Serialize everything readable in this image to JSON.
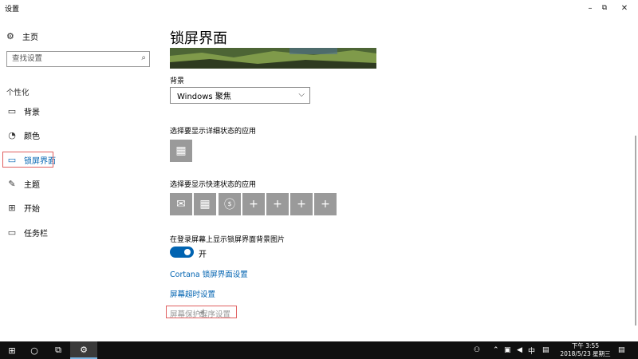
{
  "window": {
    "title": "设置",
    "minimize_icon": "minimize-icon",
    "maximize_icon": "restore-icon",
    "close_icon": "close-icon"
  },
  "sidebar": {
    "home_label": "主页",
    "search_placeholder": "查找设置",
    "section": "个性化",
    "items": [
      {
        "label": "背景",
        "icon": "picture-icon"
      },
      {
        "label": "颜色",
        "icon": "palette-icon"
      },
      {
        "label": "锁屏界面",
        "icon": "lock-screen-icon",
        "active": true
      },
      {
        "label": "主题",
        "icon": "brush-icon"
      },
      {
        "label": "开始",
        "icon": "start-grid-icon"
      },
      {
        "label": "任务栏",
        "icon": "taskbar-icon"
      }
    ]
  },
  "main": {
    "title": "锁屏界面",
    "background_label": "背景",
    "background_value": "Windows 聚焦",
    "detailed_status_label": "选择要显示详细状态的应用",
    "quick_status_label": "选择要显示快速状态的应用",
    "signin_bg_label": "在登录屏幕上显示锁屏界面背景图片",
    "signin_bg_state": "开",
    "links": {
      "cortana": "Cortana 锁屏界面设置",
      "timeout": "屏幕超时设置",
      "screensaver": "屏幕保护程序设置"
    },
    "quick_tiles": [
      "mail-icon",
      "calendar-icon",
      "skype-icon",
      "plus-icon",
      "plus-icon",
      "plus-icon",
      "plus-icon"
    ]
  },
  "taskbar": {
    "time": "下午 3:55",
    "date": "2018/5/23 星期三",
    "ime": "中",
    "colors": {
      "accent": "#0063b1",
      "highlight_box": "#e06060"
    }
  }
}
